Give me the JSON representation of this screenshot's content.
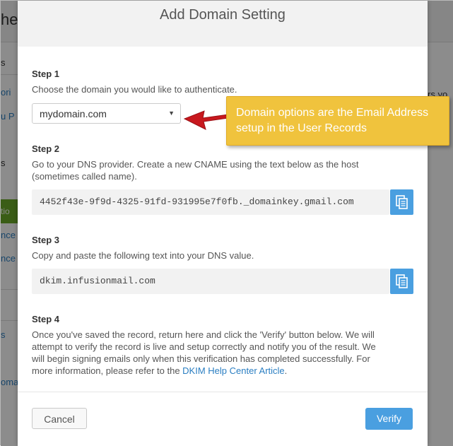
{
  "background": {
    "logo_fragment": "he",
    "sidebar_fragments": [
      "s",
      "ori",
      "u P",
      "s",
      "tio",
      "nce",
      "nce",
      "s",
      "oma"
    ],
    "right_fragment": "rs yo"
  },
  "modal": {
    "title": "Add Domain Setting",
    "step1": {
      "title": "Step 1",
      "text": "Choose the domain you would like to authenticate.",
      "select_value": "mydomain.com"
    },
    "step2": {
      "title": "Step 2",
      "text_line1": "Go to your DNS provider. Create a new CNAME using the text below as the host",
      "text_line2": "(sometimes called name).",
      "code": "4452f43e-9f9d-4325-91fd-931995e7f0fb._domainkey.gmail.com"
    },
    "step3": {
      "title": "Step 3",
      "text": "Copy and paste the following text into your DNS value.",
      "code": "dkim.infusionmail.com"
    },
    "step4": {
      "title": "Step 4",
      "text_line1": "Once you've saved the record, return here and click the 'Verify' button below. We will",
      "text_line2": "attempt to verify the record is live and setup correctly and notify you of the result. We",
      "text_line3": "will begin signing emails only when this verification has completed successfully. For",
      "text_line4_prefix": "more information, please refer to the ",
      "link": "DKIM Help Center Article",
      "text_line4_suffix": "."
    },
    "cancel_label": "Cancel",
    "verify_label": "Verify"
  },
  "annotation": {
    "line1": "Domain options are the Email Address",
    "line2": "setup in the User Records"
  },
  "colors": {
    "accent": "#4a9fe0",
    "callout": "#f0c33d",
    "arrow": "#c8181e",
    "link": "#2a7ec2"
  }
}
